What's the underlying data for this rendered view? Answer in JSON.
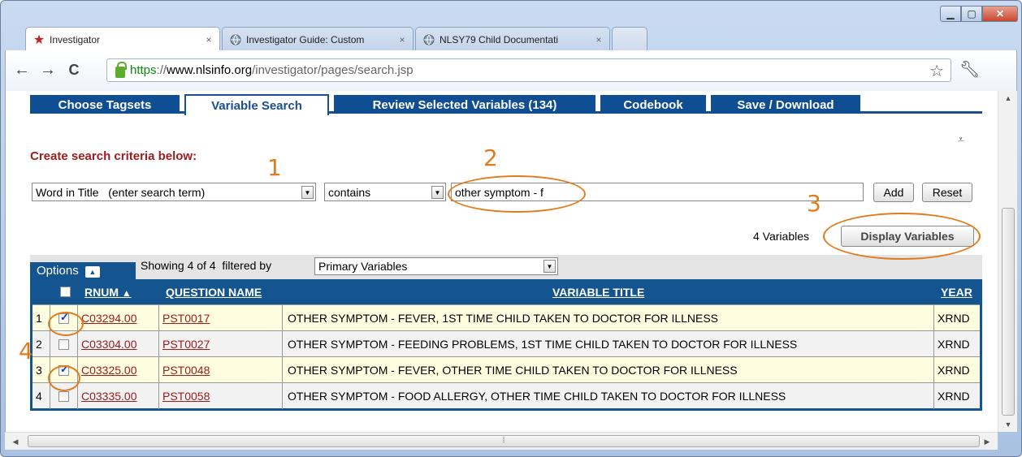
{
  "browser": {
    "tabs": [
      {
        "title": "Investigator",
        "icon": "star-icon"
      },
      {
        "title": "Investigator Guide: Custom",
        "icon": "globe-icon"
      },
      {
        "title": "NLSY79 Child Documentati",
        "icon": "globe-icon"
      }
    ],
    "url": {
      "scheme": "https",
      "sep": "://",
      "host": "www.nlsinfo.org",
      "path": "/investigator/pages/search.jsp"
    }
  },
  "site_tabs": [
    "Choose Tagsets",
    "Variable Search",
    "Review Selected Variables (134)",
    "Codebook",
    "Save / Download"
  ],
  "search": {
    "heading": "Create search criteria below:",
    "field_select": "Word in Title   (enter search term)",
    "operator_select": "contains",
    "term_value": "other symptom - f",
    "add_label": "Add",
    "reset_label": "Reset",
    "count_label": "4 Variables",
    "display_label": "Display Variables"
  },
  "options": {
    "label": "Options",
    "showing": "Showing 4 of 4  filtered by",
    "filter_select": "Primary Variables"
  },
  "table": {
    "headers": {
      "rnum": "RNUM",
      "question": "QUESTION NAME",
      "title": "VARIABLE TITLE",
      "year": "YEAR"
    },
    "rows": [
      {
        "n": "1",
        "checked": true,
        "rnum": "C03294.00",
        "q": "PST0017",
        "title": "OTHER SYMPTOM - FEVER, 1ST TIME CHILD TAKEN TO DOCTOR FOR ILLNESS",
        "year": "XRND"
      },
      {
        "n": "2",
        "checked": false,
        "rnum": "C03304.00",
        "q": "PST0027",
        "title": "OTHER SYMPTOM - FEEDING PROBLEMS, 1ST TIME CHILD TAKEN TO DOCTOR FOR ILLNESS",
        "year": "XRND"
      },
      {
        "n": "3",
        "checked": true,
        "rnum": "C03325.00",
        "q": "PST0048",
        "title": "OTHER SYMPTOM - FEVER, OTHER TIME CHILD TAKEN TO DOCTOR FOR ILLNESS",
        "year": "XRND"
      },
      {
        "n": "4",
        "checked": false,
        "rnum": "C03335.00",
        "q": "PST0058",
        "title": "OTHER SYMPTOM - FOOD ALLERGY, OTHER TIME CHILD TAKEN TO DOCTOR FOR ILLNESS",
        "year": "XRND"
      }
    ]
  },
  "annotations": [
    "1",
    "2",
    "3",
    "4"
  ],
  "colors": {
    "accent": "#15558f",
    "link": "#a01c1c",
    "annotation": "#e27b1c"
  }
}
